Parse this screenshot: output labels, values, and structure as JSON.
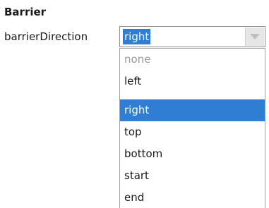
{
  "section": {
    "title": "Barrier"
  },
  "property": {
    "label": "barrierDirection",
    "selected_value": "right"
  },
  "dropdown": {
    "options": [
      {
        "label": "none",
        "state": "disabled"
      },
      {
        "label": "left",
        "state": "normal"
      },
      {
        "label": "right",
        "state": "selected"
      },
      {
        "label": "top",
        "state": "normal"
      },
      {
        "label": "bottom",
        "state": "normal"
      },
      {
        "label": "start",
        "state": "normal"
      },
      {
        "label": "end",
        "state": "normal"
      }
    ]
  },
  "colors": {
    "selection": "#2f7ed4",
    "disabled_text": "#9a9a9a"
  },
  "icons": {
    "combo_arrow": "chevron-down-icon"
  }
}
